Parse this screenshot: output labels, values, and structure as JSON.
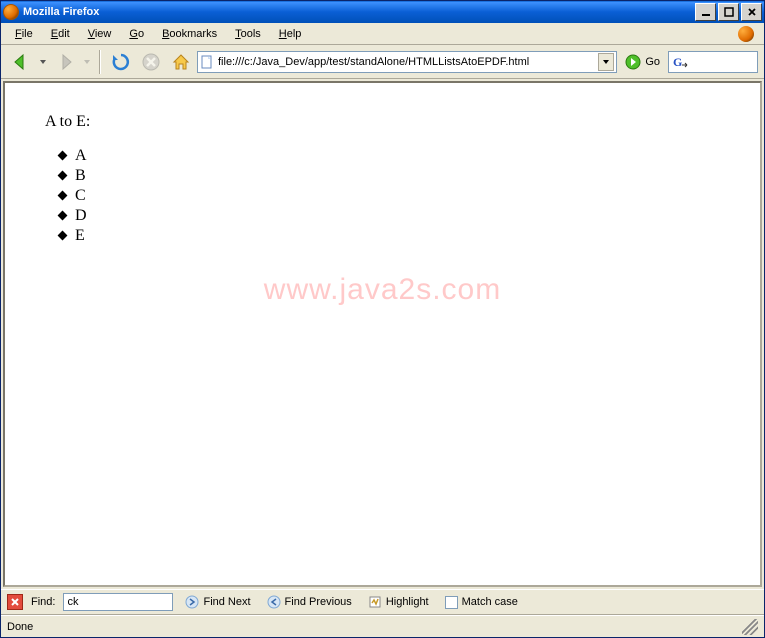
{
  "window": {
    "title": "Mozilla Firefox"
  },
  "menu": {
    "file": "File",
    "edit": "Edit",
    "view": "View",
    "go": "Go",
    "bookmarks": "Bookmarks",
    "tools": "Tools",
    "help": "Help"
  },
  "toolbar": {
    "url": "file:///c:/Java_Dev/app/test/standAlone/HTMLListsAtoEPDF.html",
    "go_label": "Go"
  },
  "content": {
    "heading": "A to E:",
    "items": [
      "A",
      "B",
      "C",
      "D",
      "E"
    ],
    "watermark": "www.java2s.com"
  },
  "findbar": {
    "label": "Find:",
    "value": "ck",
    "find_next": "Find Next",
    "find_previous": "Find Previous",
    "highlight": "Highlight",
    "match_case": "Match case"
  },
  "status": {
    "text": "Done"
  }
}
